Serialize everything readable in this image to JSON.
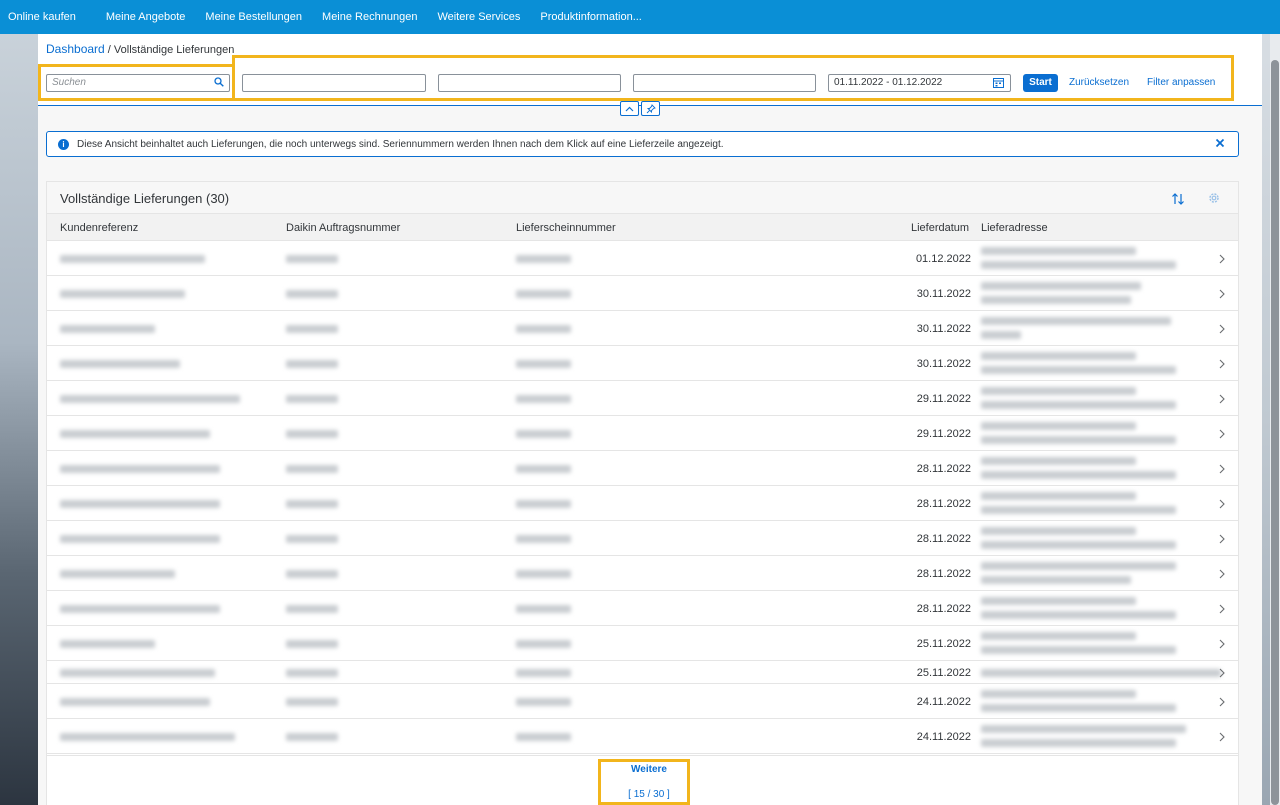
{
  "topnav": {
    "items": [
      "Online kaufen",
      "Meine Angebote",
      "Meine Bestellungen",
      "Meine Rechnungen",
      "Weitere Services",
      "Produktinformation..."
    ]
  },
  "breadcrumb": {
    "link": "Dashboard",
    "separator": "/",
    "current": "Vollständige Lieferungen"
  },
  "filterbar": {
    "search_placeholder": "Suchen",
    "date_range": "01.11.2022 - 01.12.2022",
    "start_label": "Start",
    "reset_label": "Zurücksetzen",
    "adjust_label": "Filter anpassen"
  },
  "info_strip": {
    "text": "Diese Ansicht beinhaltet auch Lieferungen, die noch unterwegs sind. Seriennummern werden Ihnen nach dem Klick auf eine Lieferzeile angezeigt."
  },
  "table": {
    "title": "Vollständige Lieferungen (30)",
    "columns": [
      "Kundenreferenz",
      "Daikin Auftragsnummer",
      "Lieferscheinnummer",
      "Lieferdatum",
      "Lieferadresse"
    ],
    "rows": [
      {
        "date": "01.12.2022"
      },
      {
        "date": "30.11.2022"
      },
      {
        "date": "30.11.2022"
      },
      {
        "date": "30.11.2022"
      },
      {
        "date": "29.11.2022"
      },
      {
        "date": "29.11.2022"
      },
      {
        "date": "28.11.2022"
      },
      {
        "date": "28.11.2022"
      },
      {
        "date": "28.11.2022"
      },
      {
        "date": "28.11.2022"
      },
      {
        "date": "28.11.2022"
      },
      {
        "date": "25.11.2022"
      },
      {
        "date": "25.11.2022"
      },
      {
        "date": "24.11.2022"
      },
      {
        "date": "24.11.2022"
      }
    ],
    "more_label": "Weitere",
    "more_count": "[ 15 / 30 ]"
  },
  "colors": {
    "nav_bg": "#0a8fd6",
    "accent": "#0a6ed1",
    "highlight": "#f2b51c"
  },
  "icons": [
    "search-icon",
    "calendar-icon",
    "chevron-up-icon",
    "pin-icon",
    "info-icon",
    "close-icon",
    "sort-icon",
    "gear-icon",
    "chevron-right-icon"
  ]
}
